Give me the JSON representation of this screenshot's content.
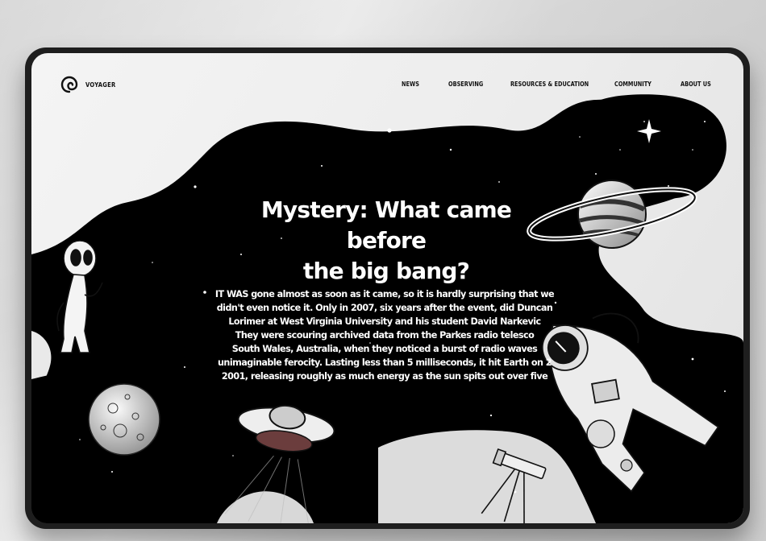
{
  "brand": {
    "name": "VOYAGER",
    "logo_icon": "spiral-logo-icon"
  },
  "nav": {
    "items": [
      {
        "label": "NEWS"
      },
      {
        "label": "OBSERVING"
      },
      {
        "label": "RESOURCES & EDUCATION"
      },
      {
        "label": "COMMUNITY"
      },
      {
        "label": "ABOUT US"
      }
    ]
  },
  "hero": {
    "title_lines": [
      "Mystery: What came before",
      "the big bang?"
    ],
    "body_lines": [
      "IT WAS gone almost as soon as it came, so it is hardly surprising that we",
      "didn't even notice it. Only in 2007, six years after the event, did Duncan",
      "Lorimer at West Virginia University and his student David Narkevic",
      "They were scouring archived data from the Parkes radio telesco",
      "South Wales, Australia, when they noticed a burst of radio waves",
      "unimaginable ferocity. Lasting less than 5 milliseconds, it hit Earth on 2",
      "2001, releasing roughly as much energy as the sun spits out over five"
    ]
  },
  "illustrations": [
    "alien",
    "moon",
    "ufo",
    "saturn-planet",
    "astronaut",
    "telescope",
    "sparkle-star"
  ],
  "colors": {
    "blob": "#000000",
    "background": "#eeeeee",
    "text_on_dark": "#ffffff",
    "frame": "#1e1e1e"
  }
}
